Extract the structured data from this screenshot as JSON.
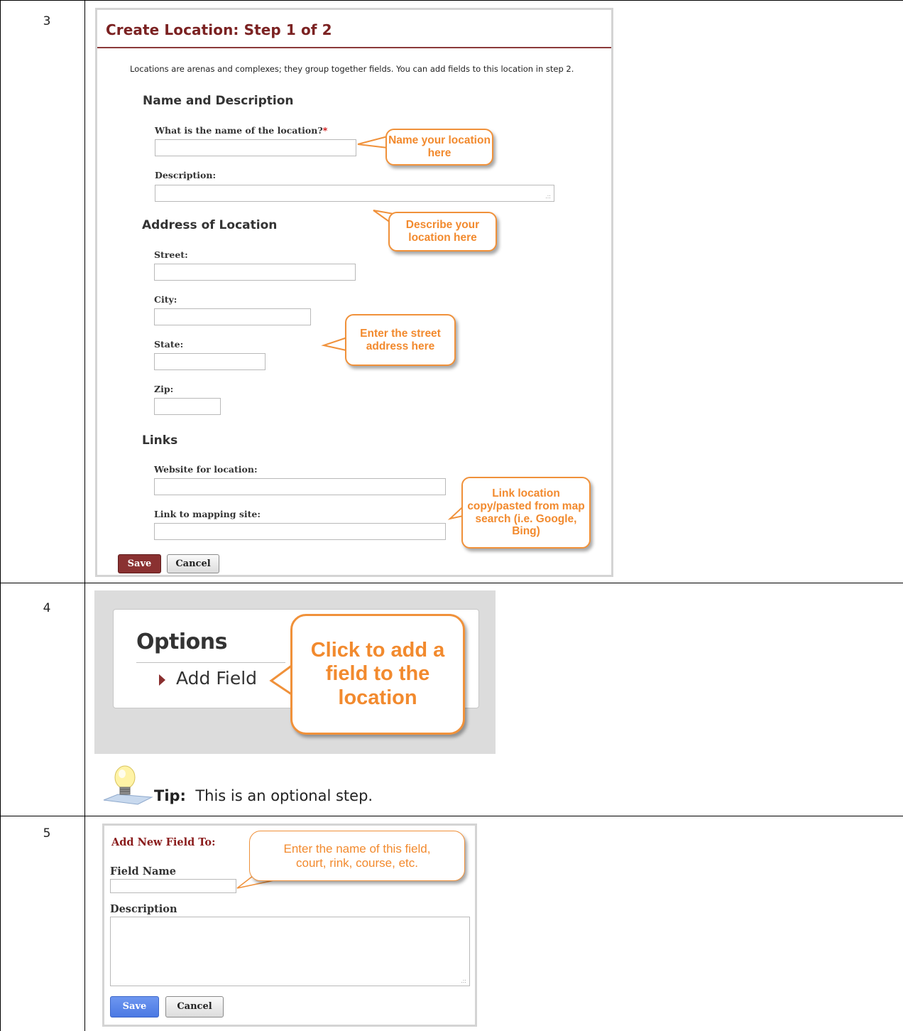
{
  "rows": [
    {
      "step": "3"
    },
    {
      "step": "4"
    },
    {
      "step": "5"
    }
  ],
  "create_location": {
    "title": "Create Location: Step 1 of 2",
    "intro": "Locations are arenas and complexes; they group together fields. You can add fields to this location in step 2.",
    "name_section": {
      "heading": "Name and Description",
      "name_label": "What is the name of the location?",
      "required_mark": "*",
      "name_value": "",
      "description_label": "Description:",
      "description_value": ""
    },
    "address_section": {
      "heading": "Address of Location",
      "street_label": "Street:",
      "city_label": "City:",
      "state_label": "State:",
      "zip_label": "Zip:"
    },
    "links_section": {
      "heading": "Links",
      "website_label": "Website for location:",
      "mapping_label": "Link to mapping site:"
    },
    "buttons": {
      "save": "Save",
      "cancel": "Cancel"
    },
    "callouts": {
      "name": "Name your location here",
      "describe": "Describe your location here",
      "street": "Enter the street address here",
      "link": "Link location copy/pasted from map search (i.e. Google, Bing)"
    }
  },
  "options": {
    "title": "Options",
    "add_field": "Add Field",
    "callout": "Click to add a field to the location"
  },
  "tip": {
    "label": "Tip:",
    "text": "This is an optional step."
  },
  "add_field_form": {
    "heading": "Add New Field To:",
    "field_name_label": "Field Name",
    "description_label": "Description",
    "callout": "Enter the name of this field, court, rink, course, etc.",
    "buttons": {
      "save": "Save",
      "cancel": "Cancel"
    }
  },
  "colors": {
    "title_red": "#7b2222",
    "save_red": "#8a3131",
    "callout_orange": "#f28a2e",
    "save_blue": "#4a78e3"
  }
}
